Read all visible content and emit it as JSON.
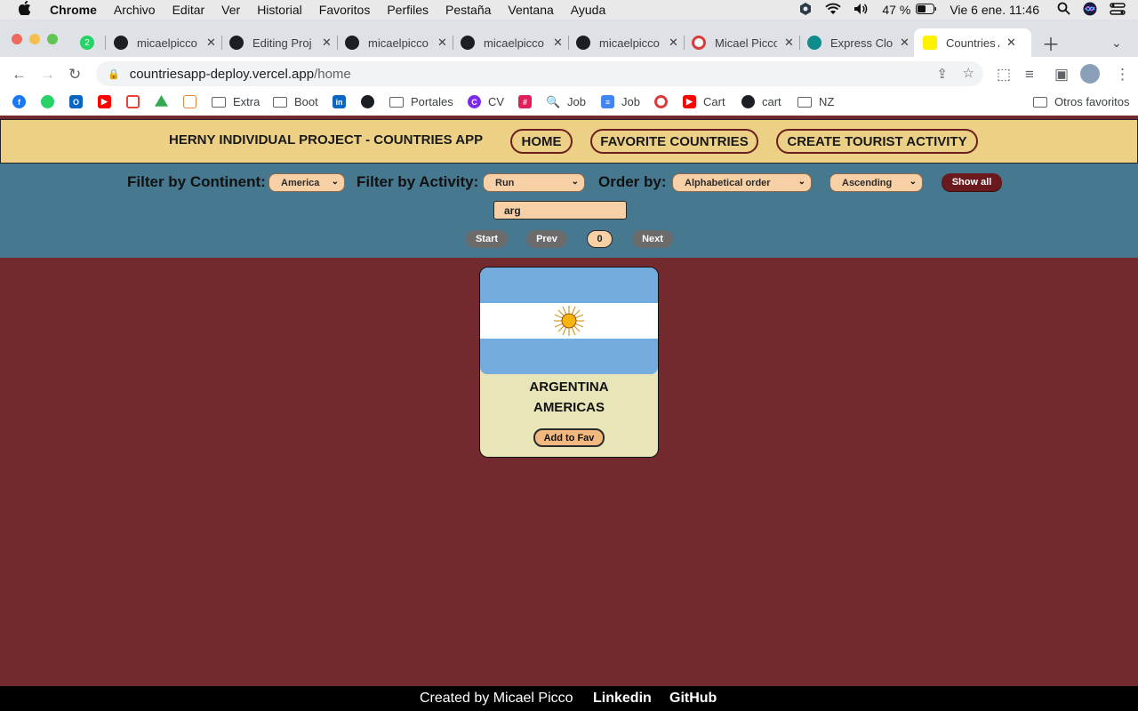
{
  "os_menubar": {
    "app_name": "Chrome",
    "menus": [
      "Archivo",
      "Editar",
      "Ver",
      "Historial",
      "Favoritos",
      "Perfiles",
      "Pestaña",
      "Ventana",
      "Ayuda"
    ],
    "battery": "47 %",
    "clock": "Vie 6 ene.  11:46"
  },
  "browser": {
    "tabs": [
      {
        "title": "micaelpicco",
        "icon": "github-icon"
      },
      {
        "title": "Editing Proj",
        "icon": "github-icon"
      },
      {
        "title": "micaelpicco",
        "icon": "github-icon"
      },
      {
        "title": "micaelpicco",
        "icon": "github-icon"
      },
      {
        "title": "micaelpicco",
        "icon": "github-icon"
      },
      {
        "title": "Micael Picco",
        "icon": "target-icon"
      },
      {
        "title": "Express Clo",
        "icon": "clockify-icon"
      },
      {
        "title": "Countries A",
        "icon": "app-icon"
      }
    ],
    "whatsapp_badge": "2",
    "url_host": "countriesapp-deploy.vercel.app",
    "url_path": "/home",
    "bookmarks": [
      {
        "label": "",
        "icon": "facebook-icon"
      },
      {
        "label": "",
        "icon": "whatsapp-icon"
      },
      {
        "label": "",
        "icon": "outlook-icon"
      },
      {
        "label": "",
        "icon": "youtube-icon"
      },
      {
        "label": "",
        "icon": "gmail-icon"
      },
      {
        "label": "",
        "icon": "drive-icon"
      },
      {
        "label": "",
        "icon": "cube-icon"
      },
      {
        "label": "Extra",
        "icon": "folder-icon"
      },
      {
        "label": "Boot",
        "icon": "folder-icon"
      },
      {
        "label": "",
        "icon": "linkedin-icon"
      },
      {
        "label": "",
        "icon": "github-icon"
      },
      {
        "label": "Portales",
        "icon": "folder-icon"
      },
      {
        "label": "CV",
        "icon": "canva-icon"
      },
      {
        "label": "",
        "icon": "slack-icon"
      },
      {
        "label": "Job",
        "icon": "magnifier-icon"
      },
      {
        "label": "Job",
        "icon": "docs-icon"
      },
      {
        "label": "",
        "icon": "target-icon"
      },
      {
        "label": "Cart",
        "icon": "youtube-icon"
      },
      {
        "label": "cart",
        "icon": "github-icon"
      },
      {
        "label": "NZ",
        "icon": "folder-icon"
      }
    ],
    "other_bookmarks": "Otros favoritos"
  },
  "app": {
    "title": "HERNY INDIVIDUAL PROJECT - COUNTRIES APP",
    "nav": {
      "home": "HOME",
      "favorites": "FAVORITE COUNTRIES",
      "create": "CREATE TOURIST ACTIVITY"
    },
    "filters": {
      "continent_label": "Filter by Continent:",
      "continent_value": "America",
      "activity_label": "Filter by Activity:",
      "activity_value": "Run",
      "order_label": "Order by:",
      "order_value": "Alphabetical order",
      "direction_value": "Ascending",
      "show_all": "Show all",
      "search_value": "arg"
    },
    "pagination": {
      "start": "Start",
      "prev": "Prev",
      "page": "0",
      "next": "Next"
    },
    "countries": [
      {
        "name": "ARGENTINA",
        "continent": "AMERICAS",
        "fav_label": "Add to Fav"
      }
    ],
    "footer": {
      "credit": "Created by Micael Picco",
      "linkedin": "Linkedin",
      "github": "GitHub"
    }
  },
  "colors": {
    "page_bg": "#722a2e",
    "header_bg": "#ecd085",
    "filter_bg": "#467890",
    "select_bg": "#f8d0a6",
    "card_bg": "#e8e6b8",
    "flag_blue": "#74acdf"
  }
}
